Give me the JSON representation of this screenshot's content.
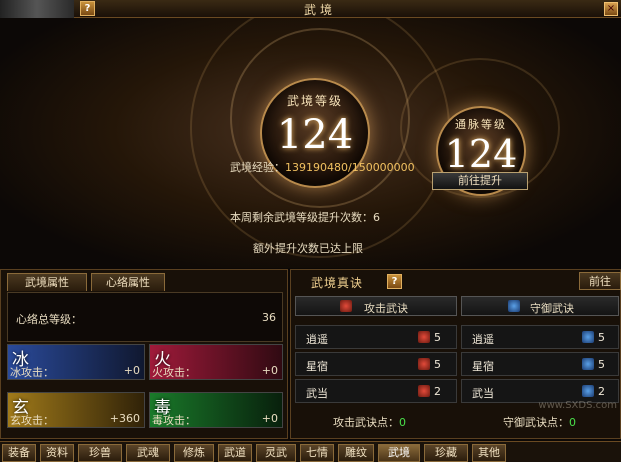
{
  "window": {
    "title": "武境",
    "help_label": "?",
    "close_label": "×"
  },
  "hero": {
    "level_label": "武境等级",
    "level_value": "124",
    "meridian_label": "通脉等级",
    "meridian_value": "124",
    "exp_label": "武境经验：",
    "exp_value": "139190480/150000000",
    "go_button": "前往提升",
    "weekly_text": "本周剩余武境等级提升次数：6",
    "extra_text": "额外提升次数已达上限"
  },
  "left_panel": {
    "tabs": [
      "武境属性",
      "心络属性"
    ],
    "total_label": "心络总等级：",
    "total_value": "36",
    "elements": [
      {
        "char": "冰",
        "label": "冰攻击：",
        "value": "+0",
        "color": "#2a4a9a"
      },
      {
        "char": "火",
        "label": "火攻击：",
        "value": "+0",
        "color": "#a01a3a"
      },
      {
        "char": "玄",
        "label": "玄攻击：",
        "value": "+360",
        "color": "#a07a1a"
      },
      {
        "char": "毒",
        "label": "毒攻击：",
        "value": "+0",
        "color": "#1a7a2a"
      }
    ]
  },
  "right_panel": {
    "title": "武境真诀",
    "go_button": "前往",
    "attack": {
      "title": "攻击武诀",
      "rows": [
        {
          "name": "逍遥",
          "value": "5"
        },
        {
          "name": "星宿",
          "value": "5"
        },
        {
          "name": "武当",
          "value": "2"
        }
      ],
      "points_label": "攻击武诀点：",
      "points_value": "0"
    },
    "defense": {
      "title": "守御武诀",
      "rows": [
        {
          "name": "逍遥",
          "value": "5"
        },
        {
          "name": "星宿",
          "value": "5"
        },
        {
          "name": "武当",
          "value": "2"
        }
      ],
      "points_label": "守御武诀点：",
      "points_value": "0"
    }
  },
  "bottom_tabs": [
    "装备",
    "资料",
    "珍兽",
    "武魂",
    "修炼",
    "武道",
    "灵武",
    "七情",
    "雕纹",
    "武境",
    "珍藏",
    "其他"
  ],
  "active_tab": "武境",
  "watermark": "www.SXDS.com"
}
